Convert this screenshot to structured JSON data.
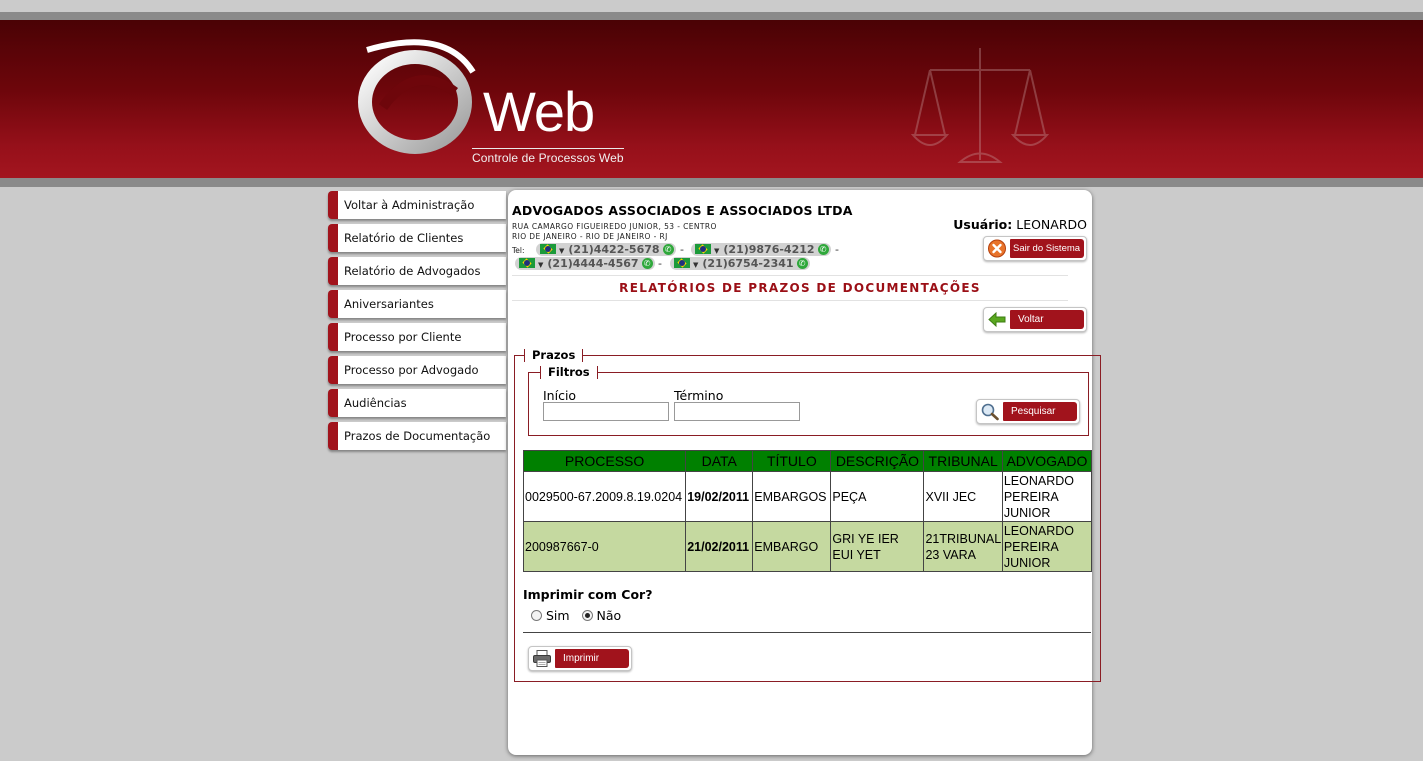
{
  "app": {
    "logo_text": "Web",
    "logo_subtitle": "Controle de Processos Web"
  },
  "sidebar": {
    "items": [
      {
        "label": "Voltar à Administração"
      },
      {
        "label": "Relatório de Clientes"
      },
      {
        "label": "Relatório de Advogados"
      },
      {
        "label": "Aniversariantes"
      },
      {
        "label": "Processo por Cliente"
      },
      {
        "label": "Processo por Advogado"
      },
      {
        "label": "Audiências"
      },
      {
        "label": "Prazos de Documentação"
      }
    ]
  },
  "company": {
    "name": "ADVOGADOS ASSOCIADOS E ASSOCIADOS LTDA",
    "address_line1": "RUA CAMARGO FIGUEIREDO JUNIOR, 53 - CENTRO",
    "address_line2": "RIO DE JANEIRO - RIO DE JANEIRO - RJ",
    "tel_label": "Tel:",
    "phones": [
      "(21)4422-5678",
      "(21)9876-4212",
      "(21)4444-4567",
      "(21)6754-2341"
    ],
    "separator": "-"
  },
  "user": {
    "label": "Usuário:",
    "name": "LEONARDO"
  },
  "buttons": {
    "logout": "Sair do Sistema",
    "back": "Voltar",
    "search": "Pesquisar",
    "print": "Imprimir"
  },
  "page": {
    "title": "RELATÓRIOS DE PRAZOS DE DOCUMENTAÇÕES"
  },
  "prazos": {
    "legend": "Prazos",
    "filters": {
      "legend": "Filtros",
      "start_label": "Início",
      "start_value": "",
      "end_label": "Término",
      "end_value": ""
    },
    "table": {
      "headers": [
        "PROCESSO",
        "DATA",
        "TÍTULO",
        "DESCRIÇÃO",
        "TRIBUNAL",
        "ADVOGADO"
      ],
      "rows": [
        [
          "0029500-67.2009.8.19.0204",
          "19/02/2011",
          "EMBARGOS",
          "PEÇA",
          "XVII JEC",
          "LEONARDO PEREIRA JUNIOR"
        ],
        [
          "200987667-0",
          "21/02/2011",
          "EMBARGO",
          "GRI YE IER EUI YET",
          "21TRIBUNAL 23 VARA",
          "LEONARDO PEREIRA JUNIOR"
        ]
      ]
    },
    "print_color": {
      "question": "Imprimir com Cor?",
      "option_yes": "Sim",
      "option_no": "Não",
      "selected": "Não"
    }
  },
  "colors": {
    "brand_red": "#a1131c",
    "header_green": "#008000",
    "alt_row": "#c5d9a0"
  }
}
